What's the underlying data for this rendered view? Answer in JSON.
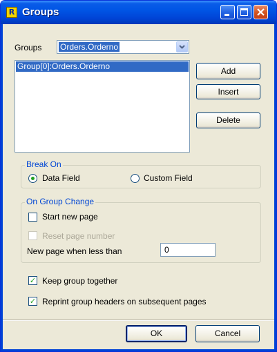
{
  "window": {
    "title": "Groups",
    "app_icon_glyph": "R",
    "controls": [
      "minimize-icon",
      "maximize-icon",
      "close-icon"
    ]
  },
  "groups": {
    "label": "Groups",
    "selected": "Orders.Orderno",
    "list_items": [
      "Group[0]:Orders.Orderno"
    ]
  },
  "buttons": {
    "add": "Add",
    "insert": "Insert",
    "delete": "Delete",
    "ok": "OK",
    "cancel": "Cancel"
  },
  "break_on": {
    "title": "Break On",
    "options": [
      "Data Field",
      "Custom Field"
    ],
    "selected": "Data Field"
  },
  "on_group_change": {
    "title": "On Group Change",
    "start_new_page": {
      "label": "Start new page",
      "checked": false
    },
    "reset_page_number": {
      "label": "Reset page number",
      "checked": false,
      "disabled": true
    },
    "new_page_label": "New page when less than",
    "new_page_value": "0"
  },
  "options": {
    "keep_together": {
      "label": "Keep group together",
      "checked": true
    },
    "reprint_headers": {
      "label": "Reprint group headers on subsequent pages",
      "checked": true
    }
  },
  "colors": {
    "titlebar": "#0055e5",
    "dialog_bg": "#ece9d8",
    "selection": "#316ac5",
    "group_title": "#0046d5",
    "check": "#21a121"
  }
}
